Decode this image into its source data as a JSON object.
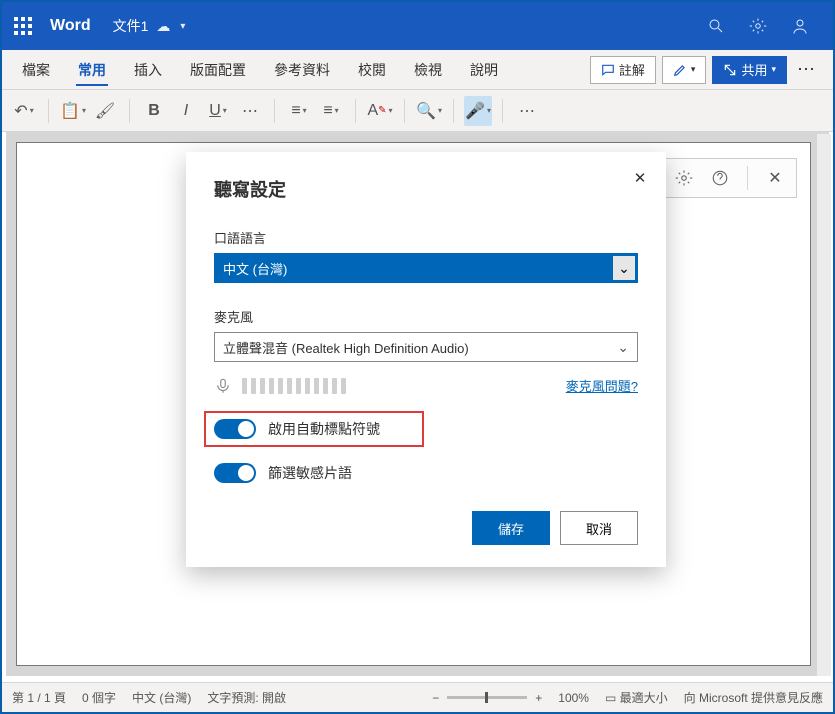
{
  "titlebar": {
    "app": "Word",
    "doc": "文件1"
  },
  "tabs": [
    "檔案",
    "常用",
    "插入",
    "版面配置",
    "參考資料",
    "校閱",
    "檢視",
    "說明"
  ],
  "tab_actions": {
    "comment": "註解",
    "share": "共用"
  },
  "dialog": {
    "title": "聽寫設定",
    "lang_label": "口語語言",
    "lang_value": "中文 (台灣)",
    "mic_label": "麥克風",
    "mic_value": "立體聲混音 (Realtek High Definition Audio)",
    "help": "麥克風問題?",
    "toggle1": "啟用自動標點符號",
    "toggle2": "篩選敏感片語",
    "save": "儲存",
    "cancel": "取消"
  },
  "status": {
    "page": "第 1 / 1 頁",
    "words": "0 個字",
    "lang": "中文 (台灣)",
    "predict": "文字預測: 開啟",
    "zoom": "100%",
    "fit": "最適大小",
    "feedback": "向 Microsoft 提供意見反應"
  }
}
